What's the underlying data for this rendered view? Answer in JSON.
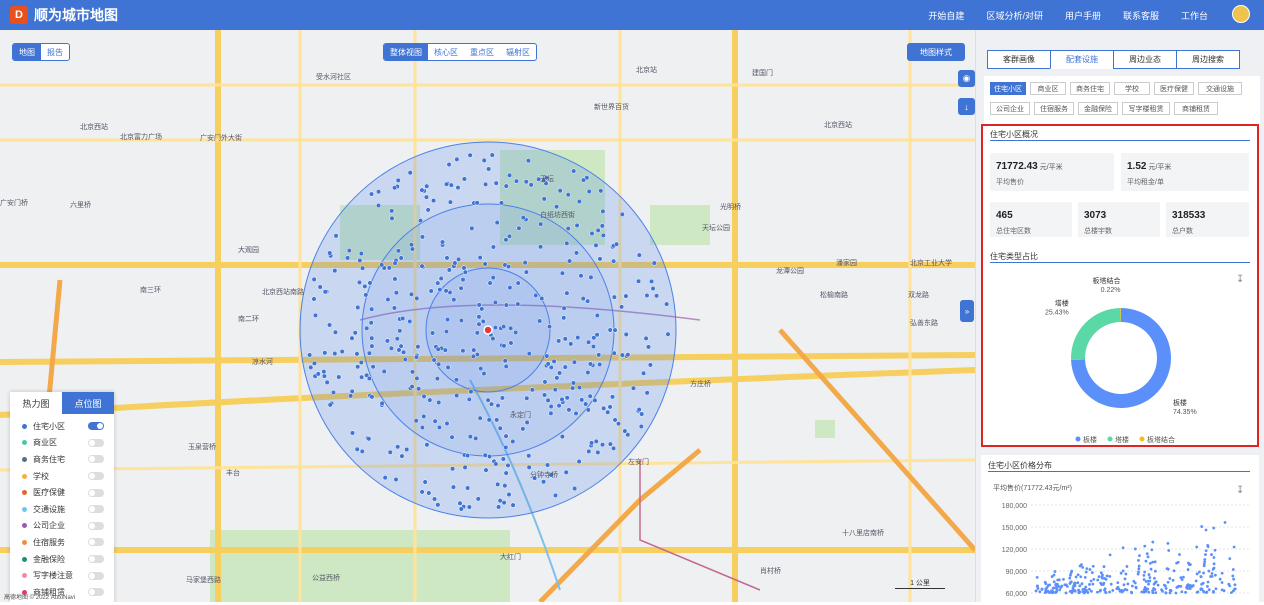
{
  "header": {
    "app_title": "顺为城市地图",
    "logo_text": "D",
    "nav": [
      "开始自建",
      "区域分析/对研",
      "用户手册",
      "联系客服",
      "工作台"
    ]
  },
  "map_controls": {
    "left_pill": [
      "地图",
      "报告"
    ],
    "center_pill": [
      "整体视图",
      "核心区",
      "重点区",
      "辐射区"
    ],
    "style_button": "地图样式",
    "expand_arrow": "»",
    "scale_label": "1 公里",
    "attribution": "高德地图 © 2022 AutoNavi"
  },
  "map_labels": [
    "受水河社区",
    "北京站",
    "建国门",
    "北京西站",
    "新世界百货",
    "北京西站",
    "北京富力广场",
    "广安门外大街",
    "广安门桥",
    "六里桥",
    "北京西站南路",
    "大观园",
    "白纸坊西街",
    "天坛公园",
    "龙潭公园",
    "光明桥",
    "潘家园",
    "北京工业大学",
    "松榆南路",
    "双龙路",
    "南二环",
    "南三环",
    "方庄桥",
    "弘善东路",
    "凉水河",
    "玉泉营桥",
    "丰台",
    "马家堡西路",
    "分钟寺桥",
    "十八里店南桥",
    "肖村桥",
    "公益西桥",
    "大红门",
    "左安门",
    "永定门",
    "天坛"
  ],
  "legend": {
    "tabs": [
      "热力图",
      "点位图"
    ],
    "items": [
      {
        "label": "住宅小区",
        "color": "#3f74d4",
        "on": true
      },
      {
        "label": "商业区",
        "color": "#4cc9a0",
        "on": false
      },
      {
        "label": "商务住宅",
        "color": "#5a6b86",
        "on": false
      },
      {
        "label": "学校",
        "color": "#f2b03c",
        "on": false
      },
      {
        "label": "医疗保健",
        "color": "#e8642c",
        "on": false
      },
      {
        "label": "交通设施",
        "color": "#6ec6f0",
        "on": false
      },
      {
        "label": "公司企业",
        "color": "#9b59b6",
        "on": false
      },
      {
        "label": "住宿服务",
        "color": "#f08c3c",
        "on": false
      },
      {
        "label": "金融保险",
        "color": "#1f8f72",
        "on": false
      },
      {
        "label": "写字楼注意",
        "color": "#f08ca0",
        "on": false
      },
      {
        "label": "商铺租赁",
        "color": "#e8357a",
        "on": false
      }
    ]
  },
  "panel": {
    "tabs": [
      "客群画像",
      "配套设施",
      "周边业态",
      "周边搜索"
    ],
    "active_tab": "配套设施",
    "categories": [
      "住宅小区",
      "商业区",
      "商务住宅",
      "学校",
      "医疗保健",
      "交通设施",
      "公司企业",
      "住宿服务",
      "金融保险",
      "写字楼租赁",
      "商铺租赁"
    ],
    "overview_title": "住宅小区概况",
    "metrics": [
      {
        "value": "71772.43",
        "unit": "元/平米",
        "label": "平均售价"
      },
      {
        "value": "1.52",
        "unit": "元/平米",
        "label": "平均租金/单"
      },
      {
        "value": "465",
        "unit": "",
        "label": "总住宅区数"
      },
      {
        "value": "3073",
        "unit": "",
        "label": "总楼宇数"
      },
      {
        "value": "318533",
        "unit": "",
        "label": "总户数"
      }
    ],
    "type_title": "住宅类型占比",
    "dist_title": "住宅小区价格分布",
    "dist_sub": "平均售价(71772.43元/m²)",
    "download_icon": "download-icon"
  },
  "chart_data": [
    {
      "type": "pie",
      "title": "住宅类型占比",
      "categories": [
        "板楼",
        "塔楼",
        "板塔结合"
      ],
      "values": [
        74.35,
        25.43,
        0.22
      ],
      "labels": [
        "74.35%",
        "25.43%",
        "0.22%"
      ],
      "colors": [
        "#5b8ff9",
        "#5ad8a6",
        "#f6bd16"
      ],
      "legend": "bottom"
    },
    {
      "type": "scatter",
      "title": "住宅小区价格分布",
      "ylim": [
        60000,
        180000
      ],
      "yticks": [
        "180,000",
        "150,000",
        "120,000",
        "90,000",
        "60,000"
      ]
    }
  ]
}
